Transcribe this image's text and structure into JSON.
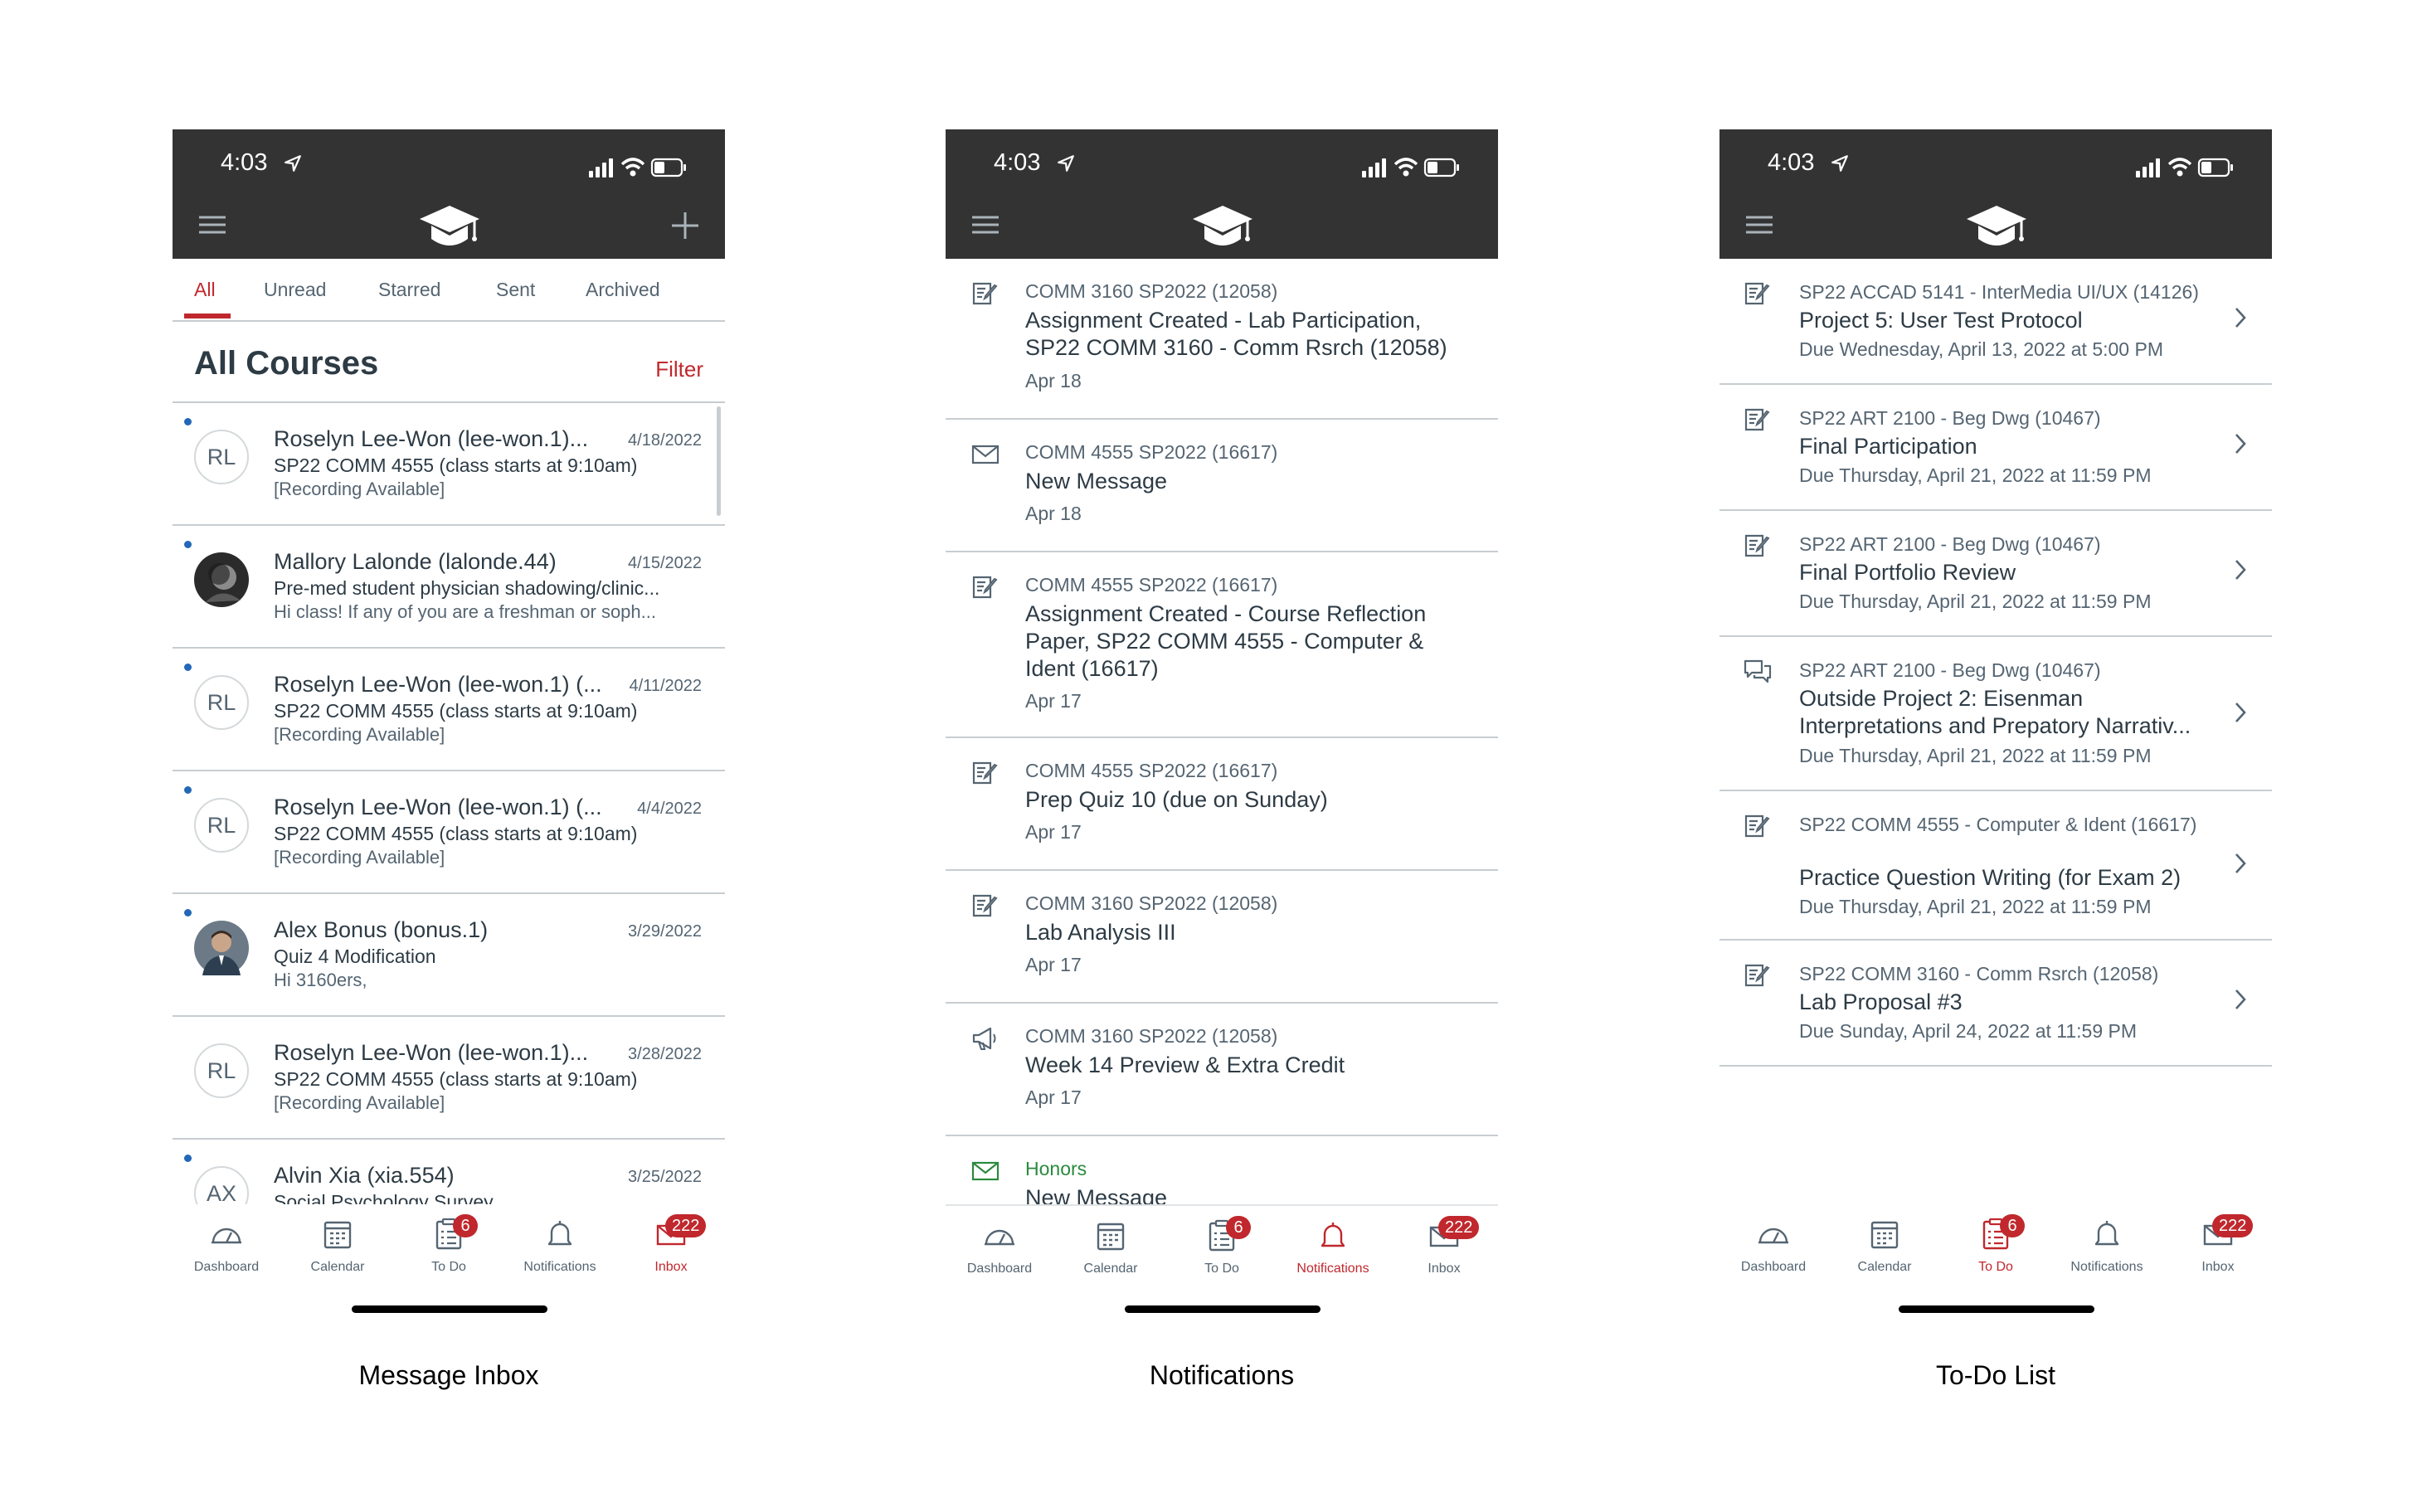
{
  "status_time": "4:03",
  "tabbar": {
    "items": [
      "Dashboard",
      "Calendar",
      "To Do",
      "Notifications",
      "Inbox"
    ],
    "todo_badge": "6",
    "inbox_badge": "222"
  },
  "inbox": {
    "caption": "Message Inbox",
    "tabs": [
      "All",
      "Unread",
      "Starred",
      "Sent",
      "Archived"
    ],
    "title": "All Courses",
    "filter": "Filter",
    "messages": [
      {
        "initials": "RL",
        "name": "Roselyn Lee-Won (lee-won.1)...",
        "date": "4/18/2022",
        "subject": "SP22 COMM 4555 (class starts at 9:10am)",
        "preview": "[Recording Available]"
      },
      {
        "initials": "",
        "name": "Mallory Lalonde (lalonde.44)",
        "date": "4/15/2022",
        "subject": "Pre-med student physician shadowing/clinic...",
        "preview": "Hi class! If any of you are a freshman or soph..."
      },
      {
        "initials": "RL",
        "name": "Roselyn Lee-Won (lee-won.1) (...",
        "date": "4/11/2022",
        "subject": "SP22 COMM 4555 (class starts at 9:10am)",
        "preview": "[Recording Available]"
      },
      {
        "initials": "RL",
        "name": "Roselyn Lee-Won (lee-won.1) (...",
        "date": "4/4/2022",
        "subject": "SP22 COMM 4555 (class starts at 9:10am)",
        "preview": "[Recording Available]"
      },
      {
        "initials": "",
        "name": "Alex Bonus (bonus.1)",
        "date": "3/29/2022",
        "subject": "Quiz 4 Modification",
        "preview": "Hi 3160ers,"
      },
      {
        "initials": "RL",
        "name": "Roselyn Lee-Won (lee-won.1)...",
        "date": "3/28/2022",
        "subject": "SP22 COMM 4555 (class starts at 9:10am)",
        "preview": "[Recording Available]"
      },
      {
        "initials": "AX",
        "name": "Alvin Xia (xia.554)",
        "date": "3/25/2022",
        "subject": "Social Psychology Survey",
        "preview": ""
      }
    ]
  },
  "notifications": {
    "caption": "Notifications",
    "items": [
      {
        "course": "COMM 3160 SP2022 (12058)",
        "title": "Assignment Created - Lab Participation, SP22 COMM 3160 - Comm Rsrch (12058)",
        "date": "Apr 18"
      },
      {
        "course": "COMM 4555 SP2022 (16617)",
        "title": "New Message",
        "date": "Apr 18"
      },
      {
        "course": "COMM 4555 SP2022 (16617)",
        "title": "Assignment Created - Course Reflection Paper, SP22 COMM 4555 - Computer & Ident (16617)",
        "date": "Apr 17"
      },
      {
        "course": "COMM 4555 SP2022 (16617)",
        "title": "Prep Quiz 10 (due on Sunday)",
        "date": "Apr 17"
      },
      {
        "course": "COMM 3160 SP2022 (12058)",
        "title": "Lab Analysis III",
        "date": "Apr 17"
      },
      {
        "course": "COMM 3160 SP2022 (12058)",
        "title": "Week 14 Preview & Extra Credit",
        "date": "Apr 17"
      },
      {
        "course": "Honors",
        "title": "New Message",
        "date": ""
      }
    ]
  },
  "todo": {
    "caption": "To-Do List",
    "items": [
      {
        "course": "SP22 ACCAD 5141 - InterMedia UI/UX (14126)",
        "title": " Project 5: User Test Protocol",
        "due": "Due Wednesday, April 13, 2022 at 5:00 PM"
      },
      {
        "course": "SP22 ART 2100 - Beg Dwg (10467)",
        "title": "Final Participation",
        "due": "Due Thursday, April 21, 2022 at 11:59 PM"
      },
      {
        "course": "SP22 ART 2100 - Beg Dwg (10467)",
        "title": "Final Portfolio Review",
        "due": "Due Thursday, April 21, 2022 at 11:59 PM"
      },
      {
        "course": "SP22 ART 2100 - Beg Dwg (10467)",
        "title": "Outside Project 2: Eisenman",
        "title2": "Interpretations and Prepatory Narrativ...",
        "due": "Due Thursday, April 21, 2022 at 11:59 PM"
      },
      {
        "course": "SP22 COMM 4555 - Computer & Ident (16617)",
        "title": "Practice Question Writing (for Exam 2)",
        "due": "Due Thursday, April 21, 2022 at 11:59 PM"
      },
      {
        "course": "SP22 COMM 3160 - Comm Rsrch (12058)",
        "title": "Lab Proposal #3",
        "due": "Due Sunday, April 24, 2022 at 11:59 PM"
      }
    ]
  },
  "colors": {
    "accent": "#c0282d",
    "header": "#333333",
    "unread": "#2367b8",
    "honors": "#2a8a3e"
  }
}
